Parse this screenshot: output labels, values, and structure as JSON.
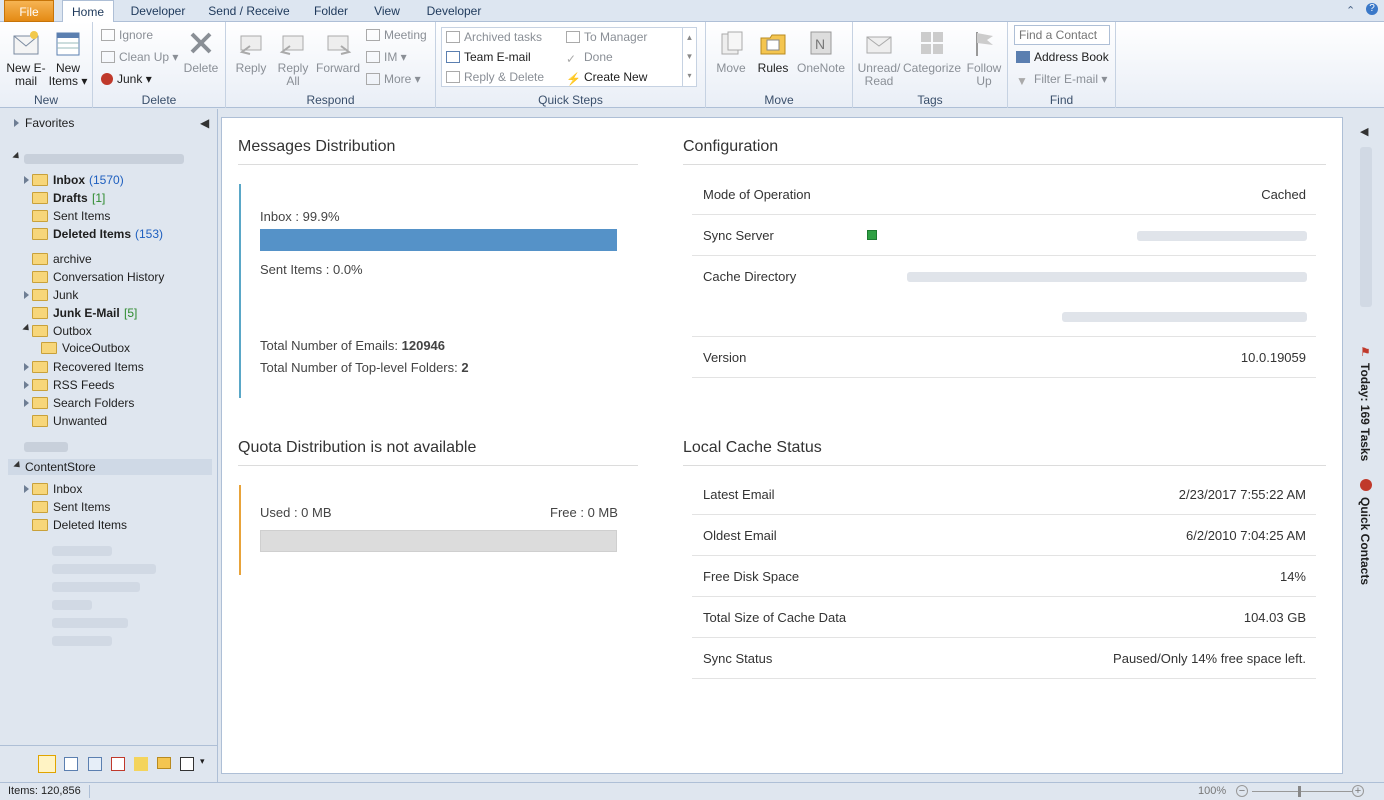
{
  "tabs": {
    "file": "File",
    "home": "Home",
    "developer1": "Developer",
    "send_receive": "Send / Receive",
    "folder": "Folder",
    "view": "View",
    "developer2": "Developer"
  },
  "ribbon": {
    "new": {
      "label": "New",
      "new_email": "New E-mail",
      "new_items": "New Items"
    },
    "delete": {
      "label": "Delete",
      "ignore": "Ignore",
      "clean_up": "Clean Up",
      "junk": "Junk",
      "delete": "Delete"
    },
    "respond": {
      "label": "Respond",
      "reply": "Reply",
      "reply_all": "Reply All",
      "forward": "Forward",
      "meeting": "Meeting",
      "im": "IM",
      "more": "More"
    },
    "quick_steps": {
      "label": "Quick Steps",
      "items": [
        "Archived tasks",
        "To Manager",
        "Team E-mail",
        "Done",
        "Reply & Delete",
        "Create New"
      ]
    },
    "move": {
      "label": "Move",
      "move": "Move",
      "rules": "Rules",
      "onenote": "OneNote"
    },
    "tags": {
      "label": "Tags",
      "unread_read": "Unread/ Read",
      "categorize": "Categorize",
      "follow_up": "Follow Up"
    },
    "find": {
      "label": "Find",
      "find_contact_placeholder": "Find a Contact",
      "address_book": "Address Book",
      "filter_email": "Filter E-mail"
    }
  },
  "nav": {
    "favorites": "Favorites",
    "mailbox1": [
      {
        "name": "Inbox",
        "count": "(1570)",
        "bold": true
      },
      {
        "name": "Drafts",
        "count": "[1]",
        "bold": true
      },
      {
        "name": "Sent Items",
        "count": ""
      },
      {
        "name": "Deleted Items",
        "count": "(153)",
        "bold": true
      },
      {
        "name": "archive",
        "count": ""
      },
      {
        "name": "Conversation History",
        "count": ""
      },
      {
        "name": "Junk",
        "count": ""
      },
      {
        "name": "Junk E-Mail",
        "count": "[5]",
        "bold": true
      },
      {
        "name": "Outbox",
        "count": ""
      },
      {
        "name": "VoiceOutbox",
        "count": ""
      },
      {
        "name": "Recovered Items",
        "count": ""
      },
      {
        "name": "RSS Feeds",
        "count": ""
      },
      {
        "name": "Search Folders",
        "count": ""
      },
      {
        "name": "Unwanted",
        "count": ""
      }
    ],
    "contentstore": "ContentStore",
    "contentstore_items": [
      "Inbox",
      "Sent Items",
      "Deleted Items"
    ]
  },
  "messages": {
    "title": "Messages Distribution",
    "inbox_label": "Inbox : 99.9%",
    "inbox_fraction": 0.999,
    "sent_label": "Sent Items : 0.0%",
    "total_emails_label": "Total Number of Emails:",
    "total_emails": "120946",
    "top_folders_label": "Total Number of Top-level Folders:",
    "top_folders": "2",
    "bar_color": "#5592c8"
  },
  "quota": {
    "title": "Quota Distribution is not available",
    "used": "Used : 0 MB",
    "free": "Free : 0 MB",
    "accent": "#e8a33a"
  },
  "configuration": {
    "title": "Configuration",
    "rows": [
      {
        "key": "Mode of Operation",
        "value": "Cached"
      },
      {
        "key": "Sync Server",
        "value": ""
      },
      {
        "key": "Cache Directory",
        "value": ""
      },
      {
        "key": "Version",
        "value": "10.0.19059"
      }
    ]
  },
  "local_cache": {
    "title": "Local Cache Status",
    "rows": [
      {
        "key": "Latest Email",
        "value": "2/23/2017 7:55:22 AM"
      },
      {
        "key": "Oldest Email",
        "value": "6/2/2010 7:04:25 AM"
      },
      {
        "key": "Free Disk Space",
        "value": "14%"
      },
      {
        "key": "Total Size of Cache Data",
        "value": "104.03 GB"
      },
      {
        "key": "Sync Status",
        "value": "Paused/Only 14% free space left."
      }
    ]
  },
  "right_bar": {
    "tasks": "Today: 169 Tasks",
    "contacts": "Quick Contacts"
  },
  "status": {
    "items": "Items: 120,856",
    "zoom": "100%"
  },
  "colors": {
    "accent_blue": "#5592c8",
    "accent_orange": "#e8a33a",
    "sync_green": "#2ea043"
  }
}
